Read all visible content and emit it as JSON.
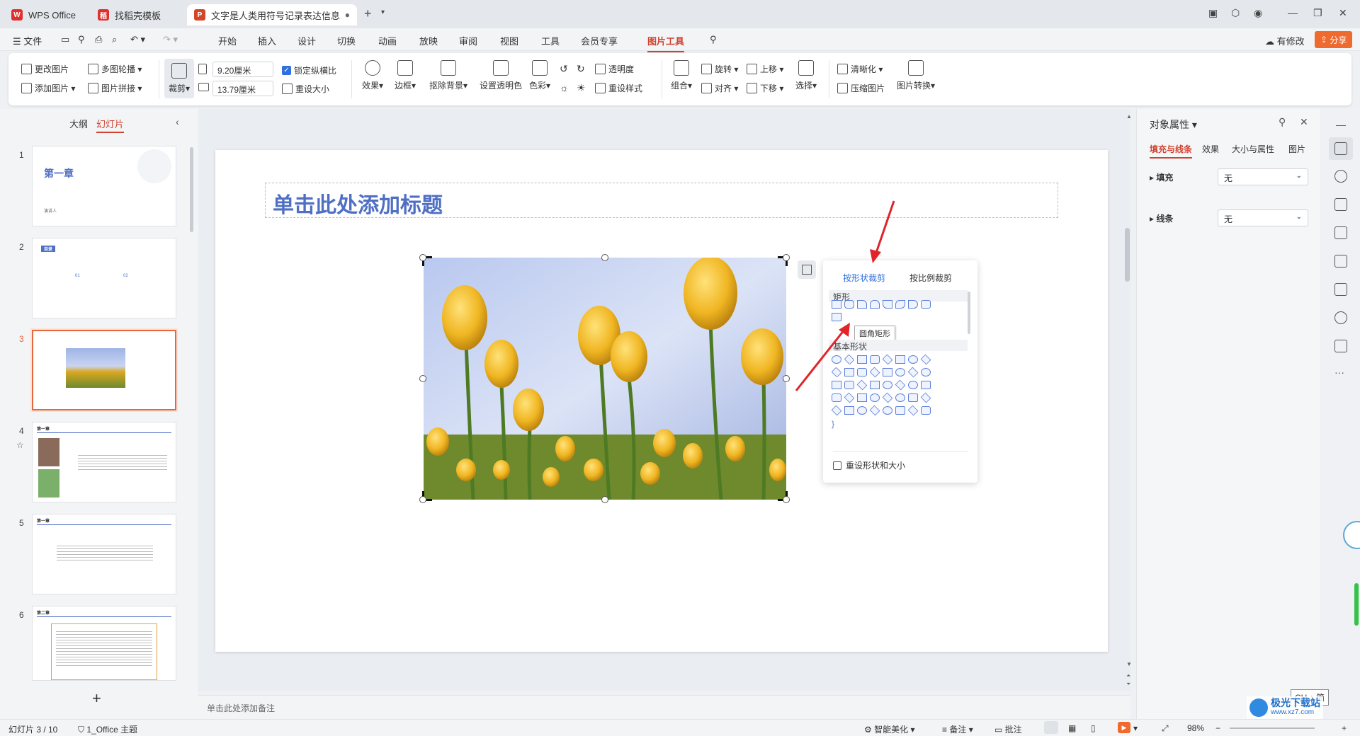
{
  "tabs": [
    {
      "label": "WPS Office",
      "icon": "wps-logo-icon"
    },
    {
      "label": "找稻壳模板",
      "icon": "docer-icon"
    },
    {
      "label": "文字是人类用符号记录表达信息以",
      "icon": "presentation-icon"
    }
  ],
  "menu": {
    "file": "文件",
    "items": [
      "开始",
      "插入",
      "设计",
      "切换",
      "动画",
      "放映",
      "审阅",
      "视图",
      "工具",
      "会员专享",
      "图片工具"
    ],
    "active": "图片工具",
    "modify": "有修改",
    "share": "分享"
  },
  "ribbon": {
    "change_pic": "更改图片",
    "add_pic": "添加图片",
    "multi_carousel": "多图轮播",
    "pic_collage": "图片拼接",
    "crop": "裁剪",
    "width_value": "9.20厘米",
    "height_value": "13.79厘米",
    "lock_ratio": "锁定纵横比",
    "reset_size": "重设大小",
    "effects": "效果",
    "border": "边框",
    "remove_bg": "抠除背景",
    "set_transparent": "设置透明色",
    "color": "色彩",
    "transparency": "透明度",
    "reset_style": "重设样式",
    "group": "组合",
    "rotate": "旋转",
    "align": "对齐",
    "bring_forward": "上移",
    "send_backward": "下移",
    "select": "选择",
    "sharpen": "清晰化",
    "compress": "压缩图片",
    "convert": "图片转换"
  },
  "left_panel": {
    "tab_outline": "大纲",
    "tab_slides": "幻灯片",
    "thumbs": [
      {
        "num": "1",
        "title": "第一章",
        "sub": "演讲人"
      },
      {
        "num": "2",
        "title": "目录",
        "items": [
          "01",
          "02"
        ]
      },
      {
        "num": "3"
      },
      {
        "num": "4",
        "title": "第一章"
      },
      {
        "num": "5",
        "title": "第一章"
      },
      {
        "num": "6",
        "title": "第二章"
      }
    ],
    "add": "+"
  },
  "slide": {
    "title_placeholder": "单击此处添加标题"
  },
  "crop_popup": {
    "tab_shape": "按形状裁剪",
    "tab_ratio": "按比例裁剪",
    "section_rect": "矩形",
    "tooltip": "圆角矩形",
    "section_basic": "基本形状",
    "reset": "重设形状和大小"
  },
  "notes_placeholder": "单击此处添加备注",
  "right_panel": {
    "title": "对象属性",
    "tabs": [
      "填充与线条",
      "效果",
      "大小与属性",
      "图片"
    ],
    "fill_label": "填充",
    "fill_value": "无",
    "line_label": "线条",
    "line_value": "无"
  },
  "status": {
    "slide_info": "幻灯片 3 / 10",
    "theme": "1_Office 主题",
    "beautify": "智能美化",
    "notes": "备注",
    "comments": "批注",
    "zoom": "98%",
    "ime": "CH ♪ 简",
    "watermark": "极光下载站",
    "watermark_url": "www.xz7.com"
  },
  "colors": {
    "accent": "#d0432f",
    "title_blue": "#4f6fc5",
    "share_orange": "#ee6a2f"
  }
}
